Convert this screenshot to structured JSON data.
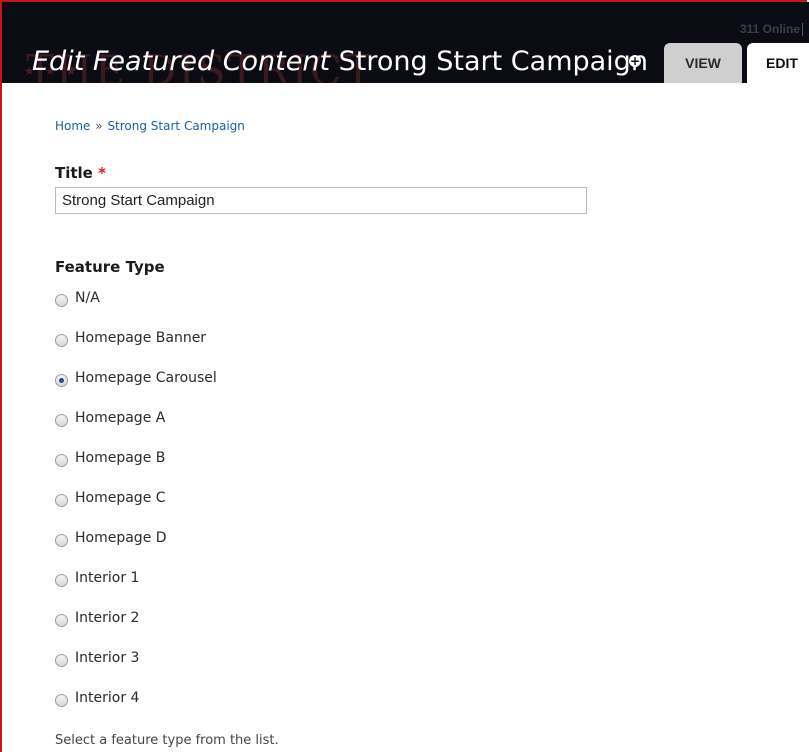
{
  "header": {
    "watermark": "THE DISTRICT",
    "top_link": "311 Online",
    "title_prefix": "Edit Featured Content",
    "title_name": "Strong Start Campaign",
    "tabs": [
      {
        "label": "VIEW",
        "active": false
      },
      {
        "label": "EDIT",
        "active": true
      }
    ]
  },
  "breadcrumb": {
    "home": "Home",
    "separator": "»",
    "current": "Strong Start Campaign"
  },
  "form": {
    "title_label": "Title",
    "required_marker": "*",
    "title_value": "Strong Start Campaign",
    "feature_type_label": "Feature Type",
    "feature_type_options": [
      {
        "label": "N/A",
        "selected": false
      },
      {
        "label": "Homepage Banner",
        "selected": false
      },
      {
        "label": "Homepage Carousel",
        "selected": true
      },
      {
        "label": "Homepage A",
        "selected": false
      },
      {
        "label": "Homepage B",
        "selected": false
      },
      {
        "label": "Homepage C",
        "selected": false
      },
      {
        "label": "Homepage D",
        "selected": false
      },
      {
        "label": "Interior 1",
        "selected": false
      },
      {
        "label": "Interior 2",
        "selected": false
      },
      {
        "label": "Interior 3",
        "selected": false
      },
      {
        "label": "Interior 4",
        "selected": false
      }
    ],
    "feature_type_help": "Select a feature type from the list."
  },
  "colors": {
    "header_bg": "#0b0b14",
    "frame_border": "#c4161c",
    "link": "#1a5fa6",
    "required": "#d11f1f"
  }
}
